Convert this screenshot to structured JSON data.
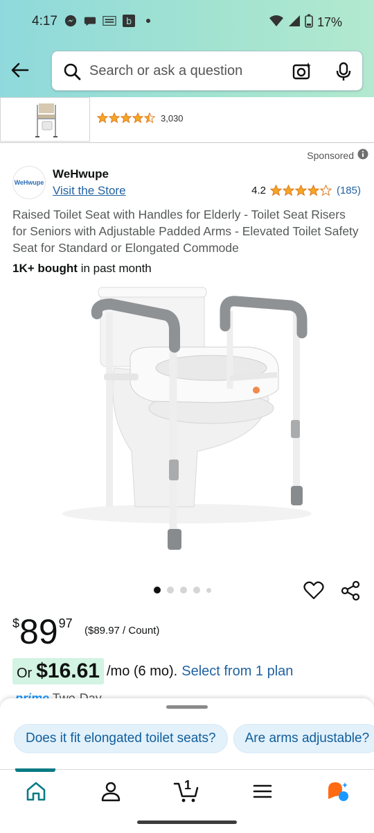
{
  "status_bar": {
    "time": "4:17",
    "battery": "17%",
    "icons": [
      "messenger-icon",
      "chat-icon",
      "temu-icon",
      "b-app-icon",
      "wifi-icon",
      "cell-signal-icon",
      "battery-icon"
    ]
  },
  "search": {
    "placeholder": "Search or ask a question"
  },
  "sticky": {
    "rating_count": "3,030",
    "stars": 4.5
  },
  "ad": {
    "sponsored": "Sponsored",
    "brand": "WeHwupe",
    "logo_text": "WeHwupe",
    "visit_store": "Visit the Store",
    "rating": "4.2",
    "rating_stars": 4.2,
    "rating_count": "(185)"
  },
  "product": {
    "title": "Raised Toilet Seat with Handles for Elderly - Toilet Seat Risers for Seniors with Adjustable Padded Arms - Elevated Toilet Safety Seat for Standard or Elongated Commode",
    "bought_bold": "1K+ bought",
    "bought_rest": " in past month",
    "image_count": 5,
    "active_image": 1
  },
  "price": {
    "currency": "$",
    "dollars": "89",
    "cents": "97",
    "unit_price": "($89.97 / Count)"
  },
  "monthly": {
    "or": "Or",
    "amount": "$16.61",
    "term": "/mo (6 mo).",
    "link": "Select from 1 plan"
  },
  "prime_peek": {
    "prime": "prime",
    "text": " Two-Day"
  },
  "questions": {
    "chips": [
      "Does it fit elongated toilet seats?",
      "Are arms adjustable?"
    ]
  },
  "nav": {
    "cart_count": "1",
    "items": [
      "home-icon",
      "account-icon",
      "cart-icon",
      "menu-icon",
      "rufus-icon"
    ]
  },
  "colors": {
    "header_gradient_start": "#8fd9dc",
    "header_gradient_end": "#b2e9cf",
    "link": "#2162a1",
    "star": "#f5a623",
    "deal_bg": "#d3f3e3",
    "chip_bg": "#e3f1fb",
    "active_tab": "#0a7b83"
  }
}
